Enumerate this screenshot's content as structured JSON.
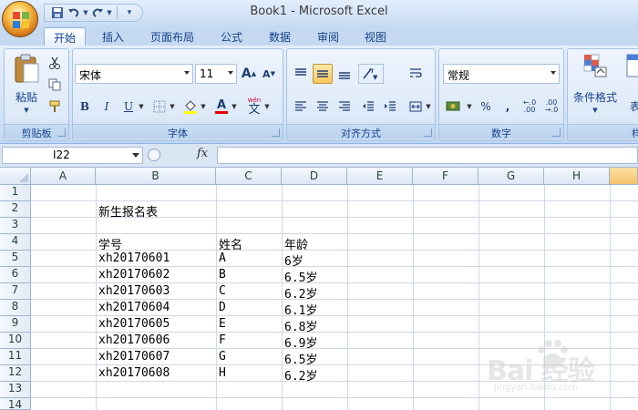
{
  "window": {
    "title": "Book1 - Microsoft Excel"
  },
  "quick_access": {
    "save_icon": "save-icon",
    "undo_icon": "undo-icon",
    "redo_icon": "redo-icon",
    "customize_icon": "customize-icon"
  },
  "tabs": [
    {
      "label": "开始",
      "active": true
    },
    {
      "label": "插入"
    },
    {
      "label": "页面布局"
    },
    {
      "label": "公式"
    },
    {
      "label": "数据"
    },
    {
      "label": "审阅"
    },
    {
      "label": "视图"
    }
  ],
  "ribbon": {
    "clipboard": {
      "label": "剪贴板",
      "paste_label": "粘贴"
    },
    "font": {
      "label": "字体",
      "font_name": "宋体",
      "font_size": "11",
      "grow": "A",
      "shrink": "A",
      "bold": "B",
      "italic": "I",
      "underline": "U",
      "phonetic": "文"
    },
    "alignment": {
      "label": "对齐方式"
    },
    "number": {
      "label": "数字",
      "format": "常规",
      "percent": "%",
      "comma": ","
    },
    "styles": {
      "conditional_label": "条件格式",
      "table_label": "表格"
    },
    "right_edge_label": "样"
  },
  "formula_bar": {
    "name_box": "I22",
    "fx": "fx",
    "value": ""
  },
  "columns": [
    "A",
    "B",
    "C",
    "D",
    "E",
    "F",
    "G",
    "H"
  ],
  "rows": [
    "1",
    "2",
    "3",
    "4",
    "5",
    "6",
    "7",
    "8",
    "9",
    "10",
    "11",
    "12",
    "13",
    "14"
  ],
  "sheet": {
    "title": "新生报名表",
    "headers": [
      "学号",
      "姓名",
      "年龄"
    ],
    "records": [
      [
        "xh20170601",
        "A",
        "6岁"
      ],
      [
        "xh20170602",
        "B",
        "6.5岁"
      ],
      [
        "xh20170603",
        "C",
        "6.2岁"
      ],
      [
        "xh20170604",
        "D",
        "6.1岁"
      ],
      [
        "xh20170605",
        "E",
        "6.8岁"
      ],
      [
        "xh20170606",
        "F",
        "6.9岁"
      ],
      [
        "xh20170607",
        "G",
        "6.5岁"
      ],
      [
        "xh20170608",
        "H",
        "6.2岁"
      ]
    ]
  },
  "watermark": {
    "text": "Bai 经验",
    "sub": "jingyan.baidu.com"
  },
  "colors": {
    "accent": "#15428b",
    "ribbon": "#dbe7f6",
    "selected_button": "#f8c75b"
  }
}
